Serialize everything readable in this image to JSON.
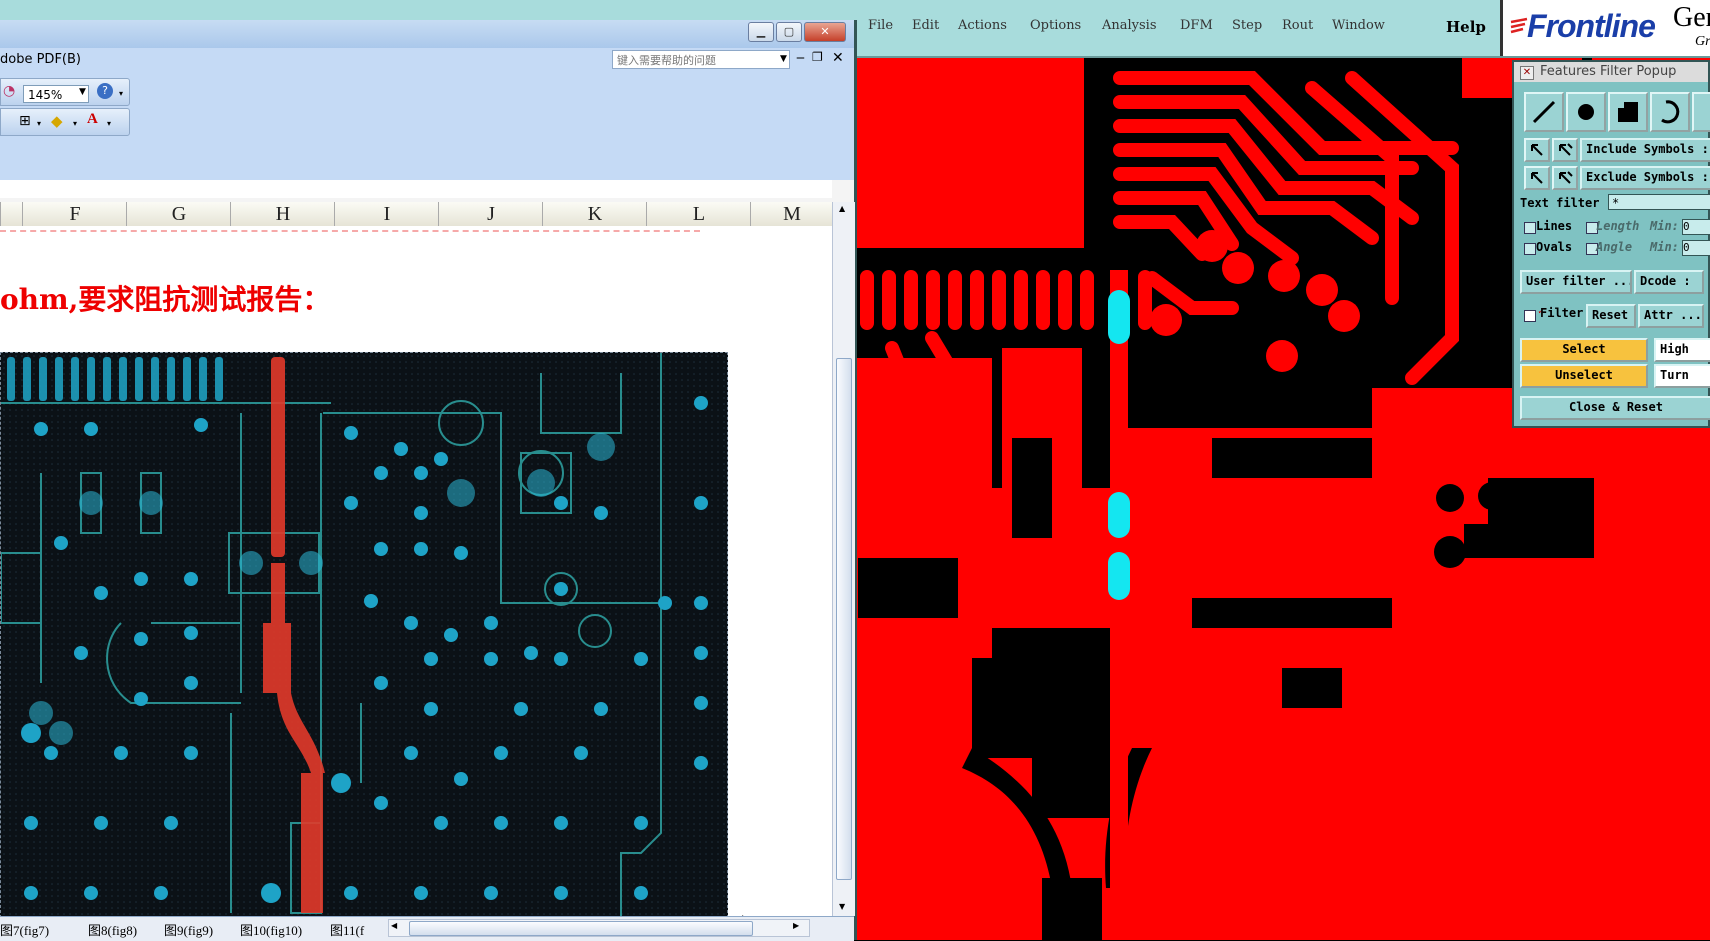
{
  "cam": {
    "menus": [
      "File",
      "Edit",
      "Actions",
      "Options",
      "Analysis",
      "DFM",
      "Step",
      "Rout",
      "Window"
    ],
    "help": "Help",
    "logo": {
      "brand": "Frontline",
      "product": "Gen",
      "sub": "Gr"
    }
  },
  "filter_popup": {
    "title": "Features Filter Popup",
    "include_symbols": "Include Symbols :",
    "exclude_symbols": "Exclude Symbols :",
    "text_filter_label": "Text filter",
    "text_filter_value": "*",
    "lines_label": "Lines",
    "ovals_label": "Ovals",
    "length_label": "Length",
    "angle_label": "Angle",
    "min_label": "Min:",
    "min_value": "0",
    "user_filter": "User filter ...",
    "dcode": "Dcode :",
    "filter": "Filter",
    "reset": "Reset",
    "attr": "Attr ...",
    "select": "Select",
    "high": "High",
    "unselect": "Unselect",
    "turn": "Turn",
    "close_reset": "Close & Reset"
  },
  "excel": {
    "adobe_menu": "dobe PDF(B)",
    "help_search_placeholder": "键入需要帮助的问题",
    "zoom": "145%",
    "columns": [
      "F",
      "G",
      "H",
      "I",
      "J",
      "K",
      "L",
      "M"
    ],
    "note_text": "ohm,要求阻抗测试报告：",
    "sheet_tabs": [
      "图7(fig7)",
      "图8(fig8)",
      "图9(fig9)",
      "图10(fig10)",
      "图11(f"
    ]
  },
  "colors": {
    "cam_copper": "#ff0000",
    "cam_highlight": "#14e6f0",
    "popup_bg": "#7fc2c2",
    "excel_note": "#e00000"
  }
}
